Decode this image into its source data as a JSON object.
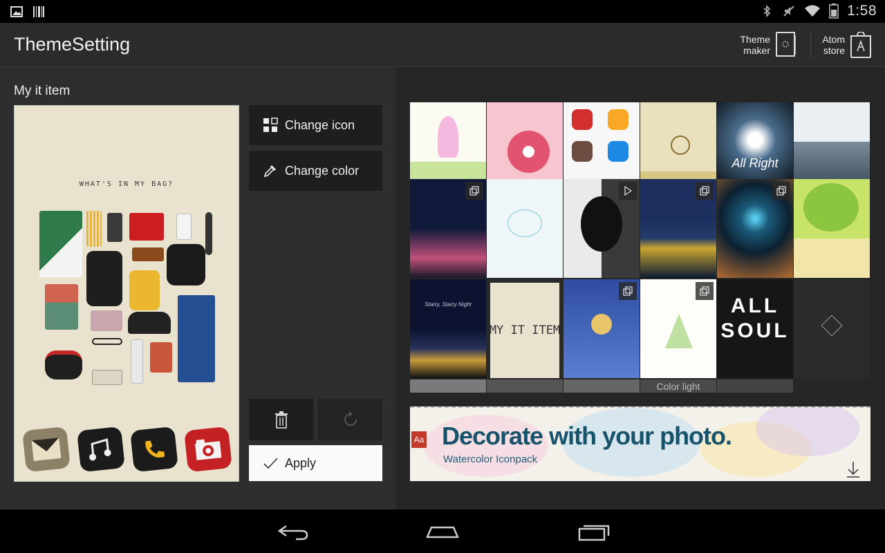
{
  "status_bar": {
    "time": "1:58",
    "left_icons": [
      "gallery-notification-icon",
      "barcode-notification-icon"
    ],
    "right_icons": [
      "bluetooth-icon",
      "mute-icon",
      "wifi-icon",
      "battery-icon"
    ]
  },
  "action_bar": {
    "title": "ThemeSetting",
    "theme_maker_label": "Theme\nmaker",
    "theme_maker_line1": "Theme",
    "theme_maker_line2": "maker",
    "atom_store_line1": "Atom",
    "atom_store_line2": "store"
  },
  "left_panel": {
    "section_title": "My it item",
    "preview_caption": "WHAT'S IN MY BAG?",
    "buttons": {
      "change_icon": "Change icon",
      "change_color": "Change color",
      "apply": "Apply"
    },
    "dock_icons": [
      "mail-icon",
      "music-icon",
      "phone-icon",
      "camera-icon"
    ]
  },
  "right_panel": {
    "tiles": [
      [
        "dancing-girl-theme",
        "cherry-blossom-theme",
        "cartoon-icons-theme",
        "tea-table-theme",
        "all-right-theme",
        "village-theme"
      ],
      [
        "starry-trees-theme",
        "penguins-theme",
        "skull-face-theme",
        "starry-night-rhone-theme",
        "fireworks-theme",
        "green-tree-theme"
      ],
      [
        "starry-starry-night-theme",
        "my-it-item-theme",
        "little-prince-theme",
        "castle-theme",
        "all-soul-theme",
        "dark-logo-theme"
      ]
    ],
    "tile_text": {
      "all_right": "All Right",
      "starry_night": "Starry, Starry Night",
      "my_it_item": "MY IT ITEM",
      "all_soul_line1": "ALL",
      "all_soul_line2": "SOUL",
      "cut_off": "Color light"
    },
    "banner": {
      "title": "Decorate with your photo.",
      "subtitle": "Watercolor Iconpack"
    }
  },
  "colors": {
    "action_bar_bg": "#2b2b2b",
    "panel_bg": "#2e2e2e",
    "button_bg": "#1e1e1e",
    "apply_bg": "#fafafa",
    "banner_title": "#17536b"
  }
}
